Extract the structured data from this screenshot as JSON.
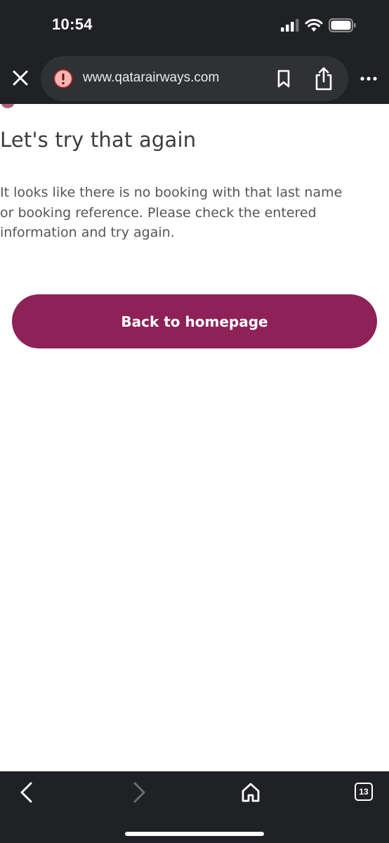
{
  "status_bar": {
    "time": "10:54",
    "icons": [
      "signal-icon",
      "wifi-icon",
      "battery-icon"
    ]
  },
  "browser": {
    "url": "www.qatarairways.com",
    "icons": [
      "close-icon",
      "alert-icon",
      "bookmark-icon",
      "share-icon",
      "more-icon"
    ],
    "tab_count": "13",
    "toolbar_icons": [
      "back-icon",
      "forward-icon",
      "home-icon",
      "tabs-icon"
    ]
  },
  "page": {
    "title": "Let's try that again",
    "message": "It looks like there is no booking with that last name or booking reference. Please check the entered information and try again.",
    "button_label": "Back to homepage"
  },
  "colors": {
    "chrome_background": "#202124",
    "url_pill": "#303134",
    "brand_button": "#8e2157",
    "alert_badge": "#f2b8b5"
  }
}
